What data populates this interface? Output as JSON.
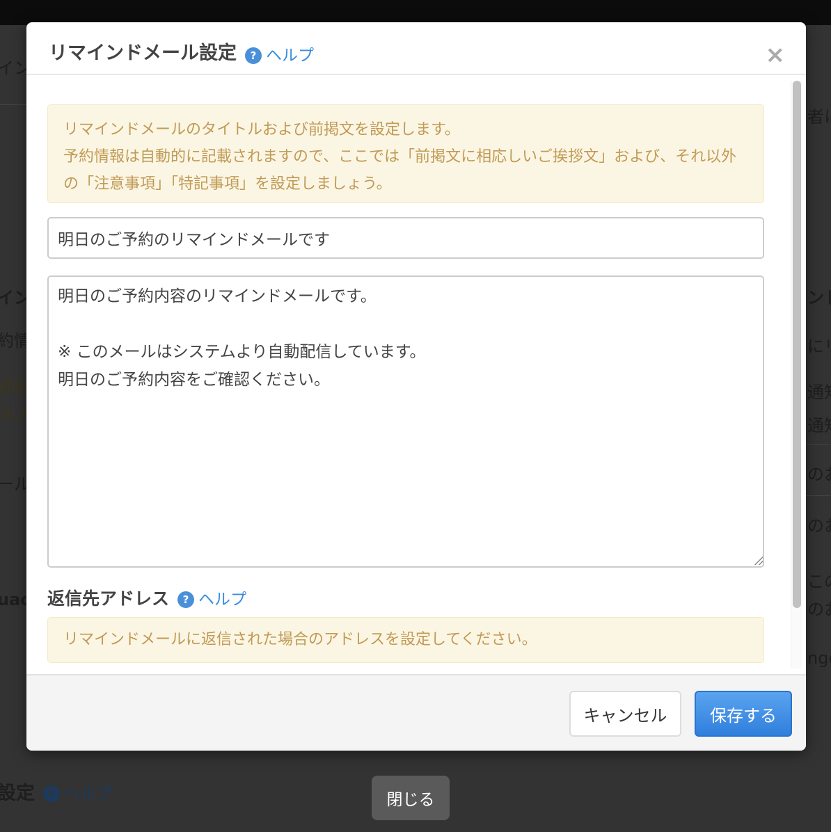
{
  "background": {
    "fragments": [
      "イン",
      "者に",
      "イン",
      "約情",
      "通知",
      "はメ",
      "ール",
      "uac",
      "ンド",
      "にリ",
      "通知",
      "通知",
      "のお",
      "のお",
      "この",
      "のお",
      "ngo"
    ],
    "section_title": "設定",
    "help_label": "ヘルプ",
    "close_button": "閉じる"
  },
  "modal": {
    "title": "リマインドメール設定",
    "help_label": "ヘルプ",
    "close_icon": "×",
    "intro_alert": [
      "リマインドメールのタイトルおよび前掲文を設定します。",
      "予約情報は自動的に記載されますので、ここでは「前掲文に相応しいご挨拶文」および、それ以外の「注意事項」「特記事項」を設定しましょう。"
    ],
    "subject_value": "明日のご予約のリマインドメールです",
    "body_value": "明日のご予約内容のリマインドメールです。\n\n※ このメールはシステムより自動配信しています。\n明日のご予約内容をご確認ください。",
    "reply_label": "返信先アドレス",
    "reply_help_label": "ヘルプ",
    "reply_alert": "リマインドメールに返信された場合のアドレスを設定してください。",
    "cancel_label": "キャンセル",
    "save_label": "保存する"
  }
}
